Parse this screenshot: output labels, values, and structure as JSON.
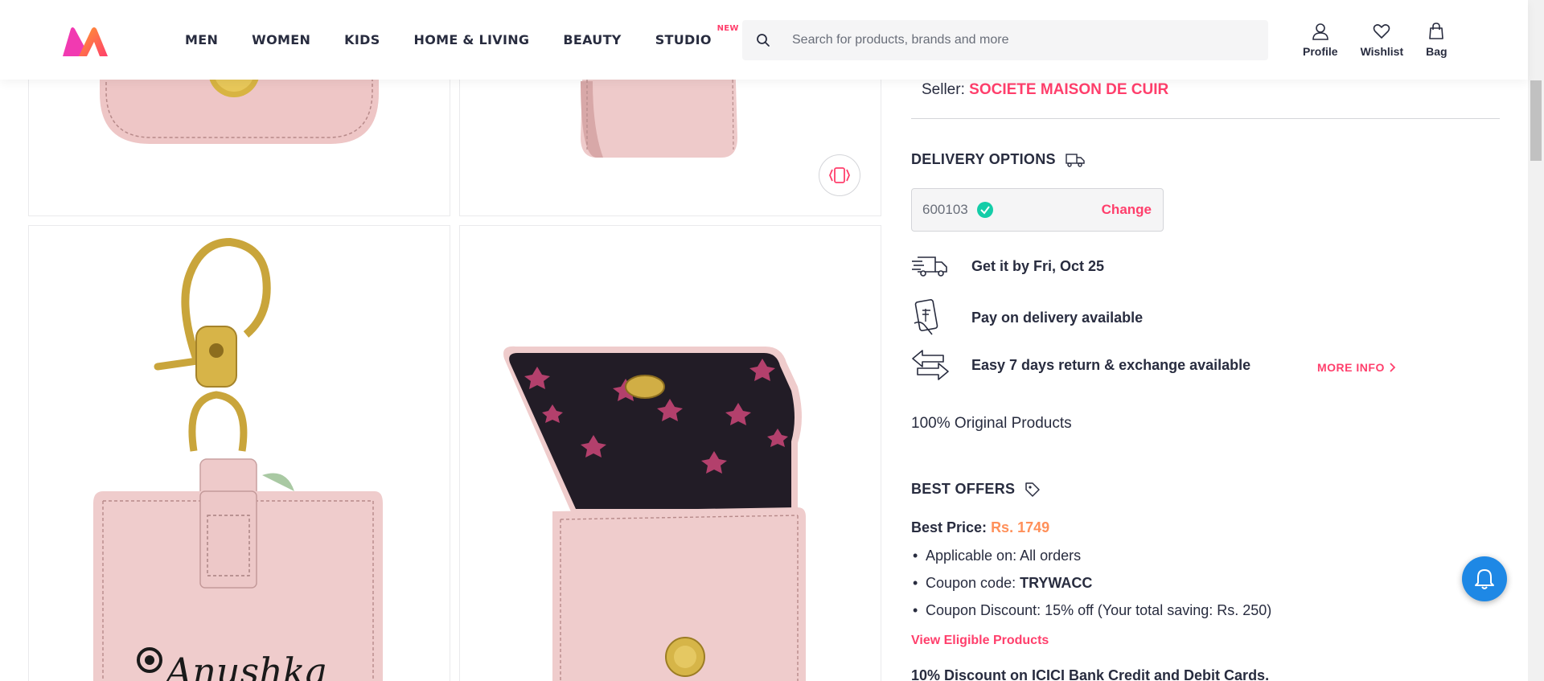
{
  "header": {
    "nav": [
      {
        "label": "MEN"
      },
      {
        "label": "WOMEN"
      },
      {
        "label": "KIDS"
      },
      {
        "label": "HOME & LIVING"
      },
      {
        "label": "BEAUTY"
      },
      {
        "label": "STUDIO",
        "badge": "NEW"
      }
    ],
    "search": {
      "placeholder": "Search for products, brands and more"
    },
    "actions": [
      {
        "label": "Profile",
        "icon": "profile-icon"
      },
      {
        "label": "Wishlist",
        "icon": "heart-icon"
      },
      {
        "label": "Bag",
        "icon": "bag-icon"
      }
    ]
  },
  "product": {
    "embroidered_text": "Anushka"
  },
  "seller": {
    "prefix": "Seller:",
    "name": "SOCIETE MAISON DE CUIR"
  },
  "delivery": {
    "title": "DELIVERY OPTIONS",
    "pincode": "600103",
    "change_label": "Change",
    "rows": [
      {
        "icon": "fast-truck-icon",
        "text": "Get it by Fri, Oct 25"
      },
      {
        "icon": "cash-card-icon",
        "text": "Pay on delivery available"
      },
      {
        "icon": "exchange-icon",
        "text": "Easy 7 days return & exchange available"
      }
    ],
    "more_info": "MORE INFO",
    "original": "100% Original Products"
  },
  "offers": {
    "title": "BEST OFFERS",
    "best_price_label": "Best Price:",
    "best_price_value": "Rs. 1749",
    "items": [
      {
        "text": "Applicable on: All orders",
        "bold": ""
      },
      {
        "text": "Coupon code: ",
        "bold": "TRYWACC"
      },
      {
        "text": "Coupon Discount: 15% off (Your total saving: Rs. 250)",
        "bold": ""
      }
    ],
    "view_eligible": "View Eligible Products",
    "icici": "10% Discount on ICICI Bank Credit and Debit Cards."
  },
  "colors": {
    "brand_pink": "#ff3f6c",
    "price_orange": "#ff905a",
    "fab_blue": "#1e88e5",
    "check_green": "#14cda8"
  }
}
